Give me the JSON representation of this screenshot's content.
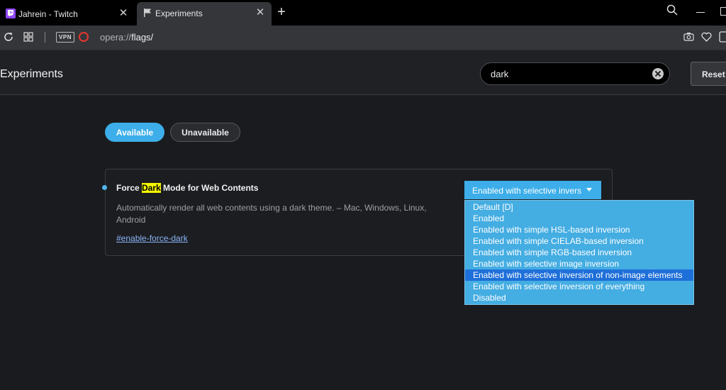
{
  "tabs": [
    {
      "title": "Jahrein - Twitch",
      "icon": "twitch-icon"
    },
    {
      "title": "Experiments",
      "icon": "flag-icon"
    }
  ],
  "toolbar": {
    "vpn_label": "VPN",
    "url_scheme": "opera://",
    "url_host": "flags/"
  },
  "header": {
    "title": "Experiments",
    "search_value": "dark",
    "reset_label": "Reset"
  },
  "filter_tabs": {
    "available": "Available",
    "unavailable": "Unavailable"
  },
  "experiment": {
    "title_before": "Force ",
    "title_highlight": "Dark",
    "title_after": " Mode for Web Contents",
    "description": "Automatically render all web contents using a dark theme. – Mac, Windows, Linux, Android",
    "link": "#enable-force-dark",
    "select_value": "Enabled with selective invers",
    "options": [
      "Default [D]",
      "Enabled",
      "Enabled with simple HSL-based inversion",
      "Enabled with simple CIELAB-based inversion",
      "Enabled with simple RGB-based inversion",
      "Enabled with selective image inversion",
      "Enabled with selective inversion of non-image elements",
      "Enabled with selective inversion of everything",
      "Disabled"
    ],
    "highlighted_option_index": 6
  },
  "colors": {
    "accent": "#3daee9",
    "highlight": "#f5f500",
    "option_selected": "#1e6fd9"
  }
}
